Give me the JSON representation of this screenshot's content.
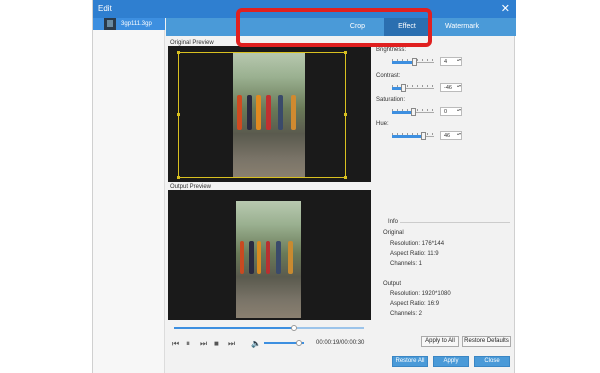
{
  "window": {
    "title": "Edit",
    "close_glyph": "✕"
  },
  "file_list": [
    {
      "name": "3gp111.3gp"
    }
  ],
  "tabs": [
    {
      "label": "Crop"
    },
    {
      "label": "Effect",
      "active": true
    },
    {
      "label": "Watermark"
    }
  ],
  "preview": {
    "original_label": "Original Preview",
    "output_label": "Output Preview"
  },
  "playback": {
    "progress": 0.63,
    "volume": 0.85,
    "timecode": "00:00:19/00:00:30"
  },
  "adjustments": [
    {
      "label": "Brightness:",
      "value": "4",
      "level": 0.52
    },
    {
      "label": "Contrast:",
      "value": "-46",
      "level": 0.27
    },
    {
      "label": "Saturation:",
      "value": "0",
      "level": 0.5
    },
    {
      "label": "Hue:",
      "value": "46",
      "level": 0.73
    }
  ],
  "info": {
    "title": "Info",
    "original": {
      "heading": "Original",
      "resolution": "Resolution: 176*144",
      "aspect": "Aspect Ratio: 11:9",
      "channels": "Channels: 1"
    },
    "output": {
      "heading": "Output",
      "resolution": "Resolution: 1920*1080",
      "aspect": "Aspect Ratio: 16:9",
      "channels": "Channels: 2"
    }
  },
  "buttons": {
    "apply_to_all": "Apply to All",
    "restore_defaults": "Restore Defaults",
    "restore_all": "Restore All",
    "apply": "Apply",
    "close": "Close"
  },
  "colors": {
    "accent": "#3d8fe0",
    "title_bar": "#2f7fd0",
    "annotation": "#e02020",
    "crop_box": "#d8c020"
  },
  "icons": {
    "play_prev": "skip-back-icon",
    "pause": "pause-icon",
    "play_next": "play-next-icon",
    "stop": "stop-icon",
    "skip_end": "skip-end-icon",
    "volume": "volume-icon"
  }
}
